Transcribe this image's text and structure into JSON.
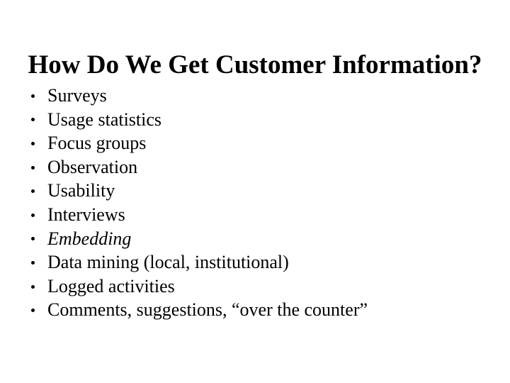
{
  "slide": {
    "title": "How Do We Get Customer Information?",
    "background_color": "#ffffff",
    "text_color": "#000000",
    "bullet_glyph": "bullet-dot",
    "items": [
      {
        "text": "Surveys",
        "style": "normal"
      },
      {
        "text": "Usage statistics",
        "style": "normal"
      },
      {
        "text": "Focus groups",
        "style": "normal"
      },
      {
        "text": "Observation",
        "style": "normal"
      },
      {
        "text": "Usability",
        "style": "normal"
      },
      {
        "text": "Interviews",
        "style": "normal"
      },
      {
        "text": "Embedding",
        "style": "italic"
      },
      {
        "text": "Data mining (local, institutional)",
        "style": "normal"
      },
      {
        "text": "Logged activities",
        "style": "normal"
      },
      {
        "text": "Comments, suggestions, “over the counter”",
        "style": "normal"
      }
    ]
  }
}
